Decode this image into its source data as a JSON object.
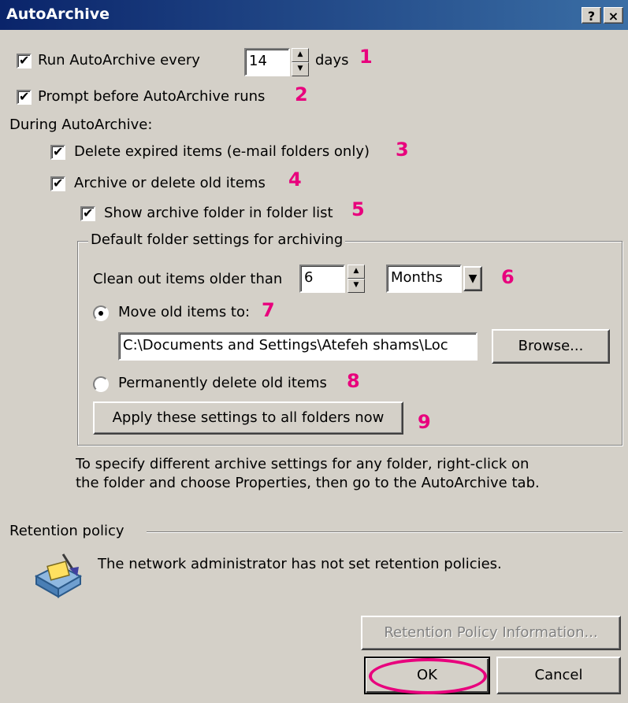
{
  "window": {
    "title": "AutoArchive",
    "help_label": "?",
    "close_label": "×"
  },
  "run_autoarchive": {
    "label": "Run AutoArchive every",
    "checked": true,
    "days_value": "14",
    "unit_label": "days",
    "marker": "1"
  },
  "prompt": {
    "label": "Prompt before AutoArchive runs",
    "checked": true,
    "marker": "2"
  },
  "during_label": "During AutoArchive:",
  "delete_expired": {
    "label": "Delete expired items (e-mail folders only)",
    "checked": true,
    "marker": "3"
  },
  "archive_old": {
    "label": "Archive or delete old items",
    "checked": true,
    "marker": "4"
  },
  "show_folder": {
    "label": "Show archive folder in folder list",
    "checked": true,
    "marker": "5"
  },
  "default_group": {
    "title": "Default folder settings for archiving",
    "clean_label": "Clean out items older than",
    "clean_value": "6",
    "period_value": "Months",
    "marker6": "6",
    "move_label": "Move old items to:",
    "move_selected": true,
    "marker7": "7",
    "path_value": "C:\\Documents and Settings\\Atefeh shams\\Loc",
    "browse_label": "Browse...",
    "delete_label": "Permanently delete old items",
    "marker8": "8",
    "apply_label": "Apply these settings to all folders now",
    "marker9": "9"
  },
  "info_text": "To specify different archive settings for any folder, right-click on the folder and choose Properties, then go to the AutoArchive tab.",
  "retention": {
    "title": "Retention policy",
    "message": "The network administrator has not set retention policies.",
    "info_button": "Retention Policy Information..."
  },
  "footer": {
    "ok_label": "OK",
    "cancel_label": "Cancel"
  },
  "colors": {
    "titlebar": "#0a246a",
    "annotation": "#e8007d",
    "face": "#d4d0c8"
  }
}
